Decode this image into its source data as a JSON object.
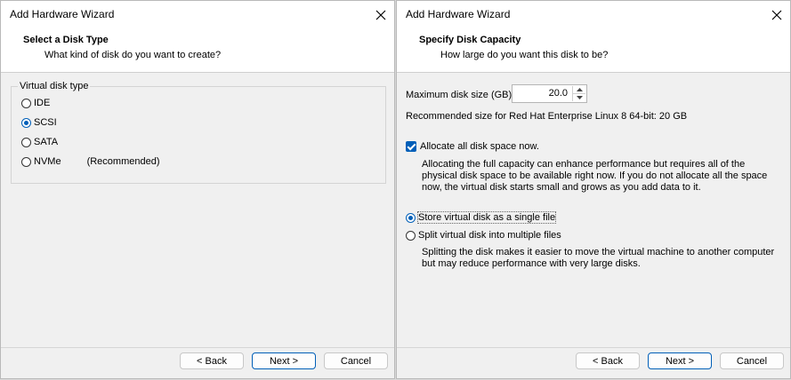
{
  "left": {
    "title": "Add Hardware Wizard",
    "header_title": "Select a Disk Type",
    "header_subtitle": "What kind of disk do you want to create?",
    "group_label": "Virtual disk type",
    "options": [
      {
        "label": "IDE",
        "checked": false,
        "note": ""
      },
      {
        "label": "SCSI",
        "checked": true,
        "note": ""
      },
      {
        "label": "SATA",
        "checked": false,
        "note": ""
      },
      {
        "label": "NVMe",
        "checked": false,
        "note": "(Recommended)"
      }
    ],
    "buttons": {
      "back": "< Back",
      "next": "Next >",
      "cancel": "Cancel"
    }
  },
  "right": {
    "title": "Add Hardware Wizard",
    "header_title": "Specify Disk Capacity",
    "header_subtitle": "How large do you want this disk to be?",
    "max_size_label": "Maximum disk size (GB):",
    "max_size_value": "20.0",
    "recommended": "Recommended size for Red Hat Enterprise Linux 8 64-bit: 20 GB",
    "allocate_label": "Allocate all disk space now.",
    "allocate_checked": true,
    "allocate_desc": "Allocating the full capacity can enhance performance but requires all of the physical disk space to be available right now. If you do not allocate all the space now, the virtual disk starts small and grows as you add data to it.",
    "store_single_label": "Store virtual disk as a single file",
    "split_label": "Split virtual disk into multiple files",
    "store_single_checked": true,
    "split_desc": "Splitting the disk makes it easier to move the virtual machine to another computer but may reduce performance with very large disks.",
    "buttons": {
      "back": "< Back",
      "next": "Next >",
      "cancel": "Cancel"
    }
  },
  "colors": {
    "accent": "#005fb8",
    "window_bg": "#f0f0f0",
    "header_bg": "#ffffff"
  },
  "icons": {
    "close": "close-icon",
    "spin_up": "chevron-up-icon",
    "spin_down": "chevron-down-icon"
  }
}
